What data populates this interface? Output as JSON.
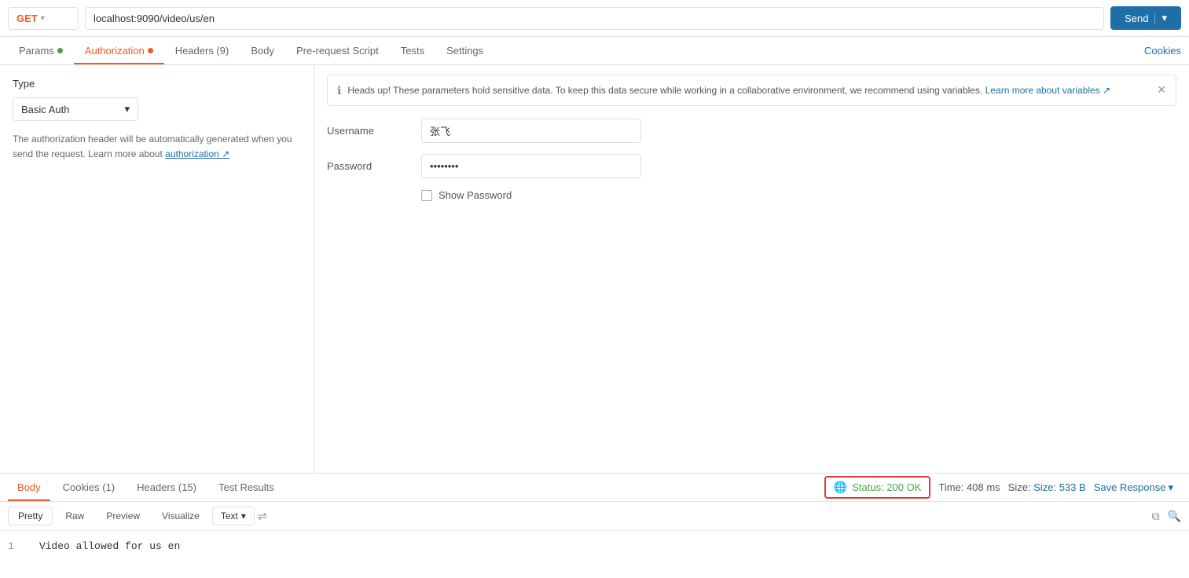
{
  "urlBar": {
    "method": "GET",
    "url": "localhost:9090/video/us/en",
    "sendLabel": "Send"
  },
  "tabs": [
    {
      "id": "params",
      "label": "Params",
      "dot": "green",
      "active": false
    },
    {
      "id": "authorization",
      "label": "Authorization",
      "dot": "orange",
      "active": true
    },
    {
      "id": "headers",
      "label": "Headers (9)",
      "dot": null,
      "active": false
    },
    {
      "id": "body",
      "label": "Body",
      "dot": null,
      "active": false
    },
    {
      "id": "pre-request",
      "label": "Pre-request Script",
      "dot": null,
      "active": false
    },
    {
      "id": "tests",
      "label": "Tests",
      "dot": null,
      "active": false
    },
    {
      "id": "settings",
      "label": "Settings",
      "dot": null,
      "active": false
    }
  ],
  "cookiesLink": "Cookies",
  "leftPanel": {
    "typeLabel": "Type",
    "typeValue": "Basic Auth",
    "infoText": "The authorization header will be automatically generated when you send the request. Learn more about",
    "authLink": "authorization ↗"
  },
  "notice": {
    "text": "Heads up! These parameters hold sensitive data. To keep this data secure while working in a collaborative environment, we recommend using variables.",
    "linkText": "Learn more about variables ↗"
  },
  "form": {
    "usernameLabel": "Username",
    "usernameValue": "张飞",
    "passwordLabel": "Password",
    "passwordValue": "••••••",
    "showPasswordLabel": "Show Password"
  },
  "bottomTabs": [
    {
      "id": "body",
      "label": "Body",
      "active": true
    },
    {
      "id": "cookies",
      "label": "Cookies (1)",
      "active": false
    },
    {
      "id": "headers",
      "label": "Headers (15)",
      "active": false
    },
    {
      "id": "test-results",
      "label": "Test Results",
      "active": false
    }
  ],
  "status": {
    "statusText": "Status: 200 OK",
    "timeText": "Time: 408 ms",
    "sizeText": "Size: 533 B",
    "saveResponse": "Save Response"
  },
  "formatBar": {
    "pretty": "Pretty",
    "raw": "Raw",
    "preview": "Preview",
    "visualize": "Visualize",
    "textOption": "Text"
  },
  "codeContent": {
    "lineNum": "1",
    "lineText": "Video allowed for us en"
  }
}
